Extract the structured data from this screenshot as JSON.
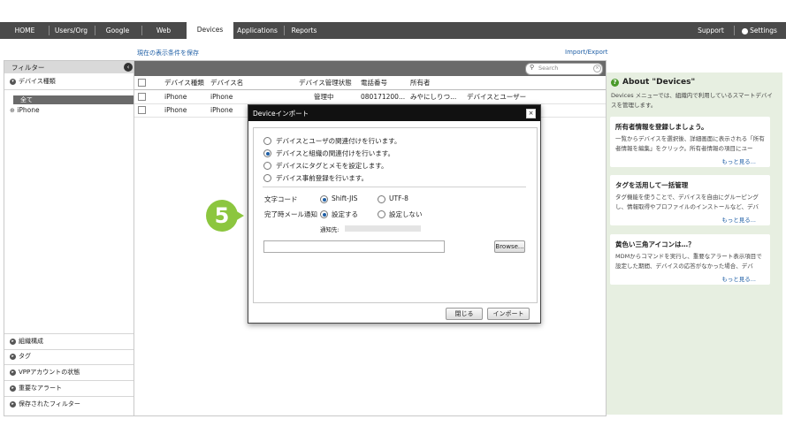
{
  "nav": {
    "tabs": [
      {
        "label": "HOME"
      },
      {
        "label": "Users/Org"
      },
      {
        "label": "Google Apps"
      },
      {
        "label": "Web Access"
      },
      {
        "label": "Devices"
      },
      {
        "label": "Applications"
      },
      {
        "label": "Reports"
      }
    ],
    "active_tab": "Devices",
    "support": "Support",
    "settings": "Settings"
  },
  "subbar": {
    "save_view": "現在の表示条件を保存",
    "import_export": "Import/Export"
  },
  "filter": {
    "title": "フィルター",
    "device_type_section": "デバイス種類",
    "items": [
      {
        "label": "全て"
      },
      {
        "label": "iPhone"
      }
    ],
    "bottom_sections": [
      {
        "label": "組織構成"
      },
      {
        "label": "タグ"
      },
      {
        "label": "VPPアカウントの状態"
      },
      {
        "label": "重要なアラート"
      },
      {
        "label": "保存されたフィルター"
      }
    ]
  },
  "table": {
    "search_placeholder": "Search",
    "headers": [
      "デバイス種類",
      "デバイス名",
      "デバイス管理状態",
      "電話番号",
      "所有者"
    ],
    "rows": [
      {
        "type": "iPhone",
        "name": "iPhone",
        "status": "管理中",
        "phone": "080171200...",
        "owner": "みやにしりつ...",
        "extra": "デバイスとユーザー"
      },
      {
        "type": "iPhone",
        "name": "iPhone",
        "status": "",
        "phone": "",
        "owner": "",
        "extra": ""
      }
    ]
  },
  "about": {
    "title": "About \"Devices\"",
    "intro": "Devices メニューでは、組織内で利用しているスマートデバイスを管理します。",
    "cards": [
      {
        "title": "所有者情報を登録しましょう。",
        "text": "一覧からデバイスを選択後、詳細画面に表示される「所有者情報を編集」をクリック。所有者情報の項目にユー",
        "more": "もっと見る..."
      },
      {
        "title": "タグを活用して一括管理",
        "text": "タグ機能を使うことで、デバイスを自由にグルーピングし、情報取得やプロファイルのインストールなど、デバ",
        "more": "もっと見る..."
      },
      {
        "title": "黄色い三角アイコンは…？",
        "text": "MDMからコマンドを実行し、重要なアラート表示項目で設定した期間、デバイスの応答がなかった場合、デバ",
        "more": "もっと見る..."
      }
    ]
  },
  "modal": {
    "title": "Deviceインポート",
    "options": [
      {
        "label": "デバイスとユーザの関連付けを行います。",
        "selected": false
      },
      {
        "label": "デバイスと組織の関連付けを行います。",
        "selected": true
      },
      {
        "label": "デバイスにタグとメモを設定します。",
        "selected": false
      },
      {
        "label": "デバイス事前登録を行います。",
        "selected": false
      }
    ],
    "charset_label": "文字コード",
    "charset_options": [
      {
        "label": "Shift-JIS",
        "selected": true
      },
      {
        "label": "UTF-8",
        "selected": false
      }
    ],
    "notify_label": "完了時メール通知",
    "notify_options": [
      {
        "label": "設定する",
        "selected": true
      },
      {
        "label": "設定しない",
        "selected": false
      }
    ],
    "notify_to_label": "通知先:",
    "browse": "Browse...",
    "close": "閉じる",
    "import": "インポート"
  },
  "step_badge": "5",
  "colors": {
    "accent_green": "#8cc63f",
    "nav_bg": "#4a4a4a",
    "link": "#1f5fa6",
    "right_panel": "#e7efe1"
  }
}
